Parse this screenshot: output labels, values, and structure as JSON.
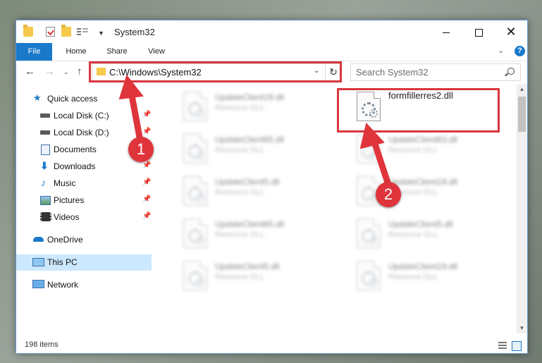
{
  "window": {
    "title": "System32"
  },
  "ribbon": {
    "tabs": [
      "File",
      "Home",
      "Share",
      "View"
    ],
    "help": "?"
  },
  "address": {
    "path": "C:\\Windows\\System32",
    "search_placeholder": "Search System32"
  },
  "nav_pane": {
    "quick_access": "Quick access",
    "items": [
      {
        "label": "Local Disk (C:)"
      },
      {
        "label": "Local Disk (D:)"
      },
      {
        "label": "Documents"
      },
      {
        "label": "Downloads"
      },
      {
        "label": "Music"
      },
      {
        "label": "Pictures"
      },
      {
        "label": "Videos"
      }
    ],
    "onedrive": "OneDrive",
    "this_pc": "This PC",
    "network": "Network"
  },
  "files": {
    "left_column": [
      {
        "name": "UpdateClient19.dll",
        "type": "Resource DLL"
      },
      {
        "name": "UpdateClient65.dll",
        "type": "Resource DLL"
      },
      {
        "name": "UpdateClient5.dll",
        "type": "Resource DLL"
      },
      {
        "name": "UpdateClient65.dll",
        "type": "Resource DLL"
      },
      {
        "name": "UpdateClient5.dll",
        "type": "Resource DLL"
      }
    ],
    "highlighted": {
      "name": "formfillerres2.dll"
    },
    "right_column": [
      {
        "name": "UpdateClient63.dll",
        "type": "Resource DLL"
      },
      {
        "name": "UpdateClient19.dll",
        "type": "Resource DLL"
      },
      {
        "name": "UpdateClient5.dll",
        "type": "Resource DLL"
      },
      {
        "name": "UpdateClient19.dll",
        "type": "Resource DLL"
      }
    ]
  },
  "status": {
    "item_count": "198 items"
  },
  "annotations": {
    "step1": "1",
    "step2": "2",
    "color": "#e0343c"
  }
}
